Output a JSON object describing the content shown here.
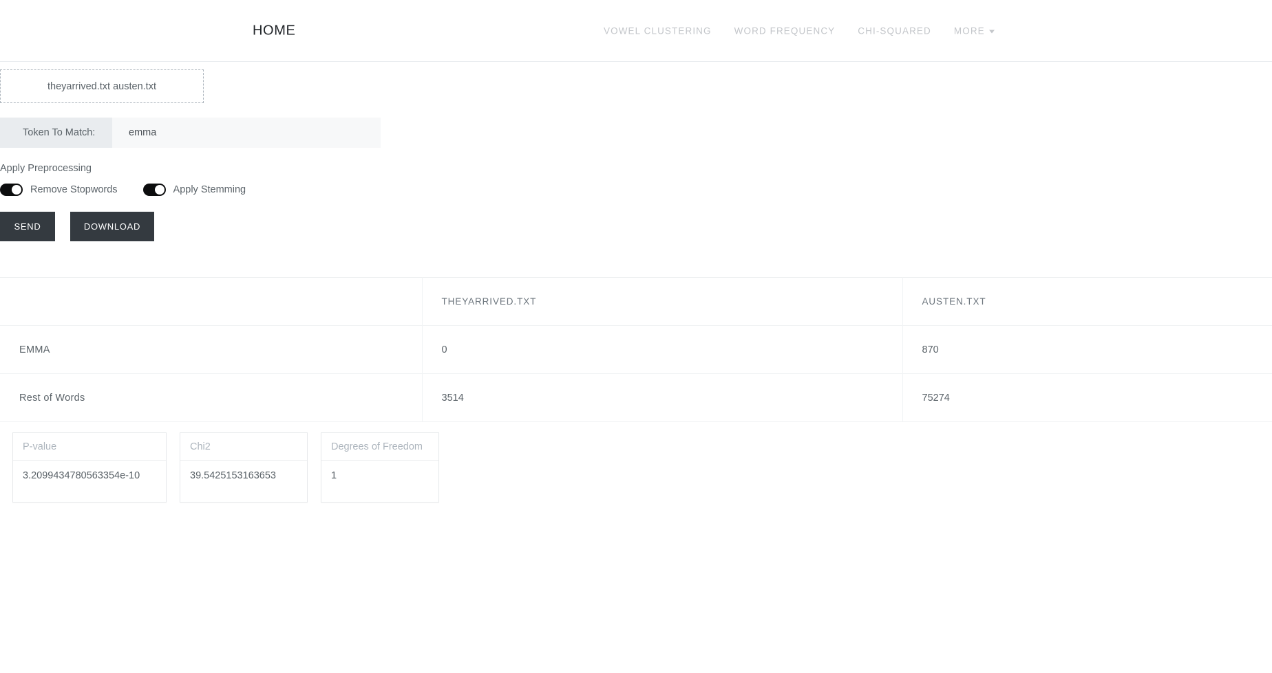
{
  "navbar": {
    "brand": "HOME",
    "links": [
      {
        "label": "VOWEL CLUSTERING",
        "name": "nav-link-vowel-clustering"
      },
      {
        "label": "WORD FREQUENCY",
        "name": "nav-link-word-frequency"
      },
      {
        "label": "CHI-SQUARED",
        "name": "nav-link-chi-squared"
      },
      {
        "label": "MORE",
        "name": "nav-link-more"
      }
    ]
  },
  "form": {
    "dropzone_text": "theyarrived.txt austen.txt",
    "token_label": "Token To Match:",
    "token_value": "emma",
    "token_placeholder": "",
    "preprocessing_title": "Apply Preprocessing",
    "switches": [
      {
        "label": "Remove Stopwords",
        "on": true
      },
      {
        "label": "Apply Stemming",
        "on": true
      }
    ],
    "send_label": "SEND",
    "download_label": "DOWNLOAD"
  },
  "table": {
    "headers": [
      "",
      "THEYARRIVED.TXT",
      "AUSTEN.TXT"
    ],
    "rows": [
      {
        "label": "EMMA",
        "values": [
          "0",
          "870"
        ]
      },
      {
        "label": "Rest of Words",
        "values": [
          "3514",
          "75274"
        ]
      }
    ]
  },
  "stats": [
    {
      "title": "P-value",
      "value": "3.2099434780563354e-10"
    },
    {
      "title": "Chi2",
      "value": "39.5425153163653"
    },
    {
      "title": "Degrees of Freedom",
      "value": "1"
    }
  ],
  "colors": {
    "button_bg": "#343a40",
    "switch_on": "#0c0d0e",
    "muted_text": "#6c757d",
    "border": "#f1f3f4"
  }
}
